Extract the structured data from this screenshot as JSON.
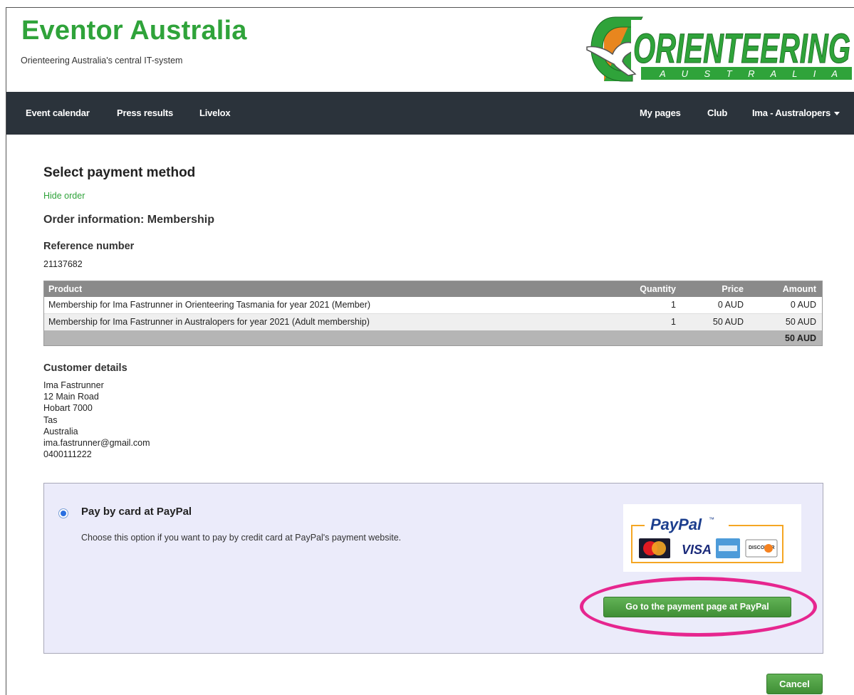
{
  "header": {
    "title": "Eventor Australia",
    "subtitle": "Orienteering Australia's central IT-system",
    "logo_text": "ORIENTEERING",
    "logo_subtext": "A U S T R A L I A"
  },
  "nav": {
    "left": [
      "Event calendar",
      "Press results",
      "Livelox"
    ],
    "right": [
      "My pages",
      "Club",
      "Ima - Australopers"
    ]
  },
  "page": {
    "heading": "Select payment method",
    "hide_order": "Hide order",
    "order_heading": "Order information: Membership",
    "reference_label": "Reference number",
    "reference_value": "21137682"
  },
  "order_table": {
    "headers": [
      "Product",
      "Quantity",
      "Price",
      "Amount"
    ],
    "rows": [
      [
        "Membership for Ima Fastrunner in Orienteering Tasmania for year 2021 (Member)",
        "1",
        "0 AUD",
        "0 AUD"
      ],
      [
        "Membership for Ima Fastrunner in Australopers for year 2021 (Adult membership)",
        "1",
        "50 AUD",
        "50 AUD"
      ]
    ],
    "total": "50 AUD"
  },
  "customer": {
    "heading": "Customer details",
    "lines": [
      "Ima Fastrunner",
      "12 Main Road",
      "Hobart 7000",
      "Tas",
      "Australia",
      "ima.fastrunner@gmail.com",
      "0400111222"
    ]
  },
  "payment": {
    "option_title": "Pay by card at PayPal",
    "option_desc": "Choose this option if you want to pay by credit card at PayPal's payment website.",
    "paypal_logo_text": "PayPal",
    "paypal_tm": "™",
    "card_visa": "VISA",
    "card_discover": "DISCOVER",
    "go_button": "Go to the payment page at PayPal",
    "cancel_button": "Cancel"
  },
  "colors": {
    "brand_green": "#2fa33a",
    "nav_bg": "#2b333b",
    "highlight": "#e6268f",
    "pay_panel_bg": "#ebebfa"
  }
}
